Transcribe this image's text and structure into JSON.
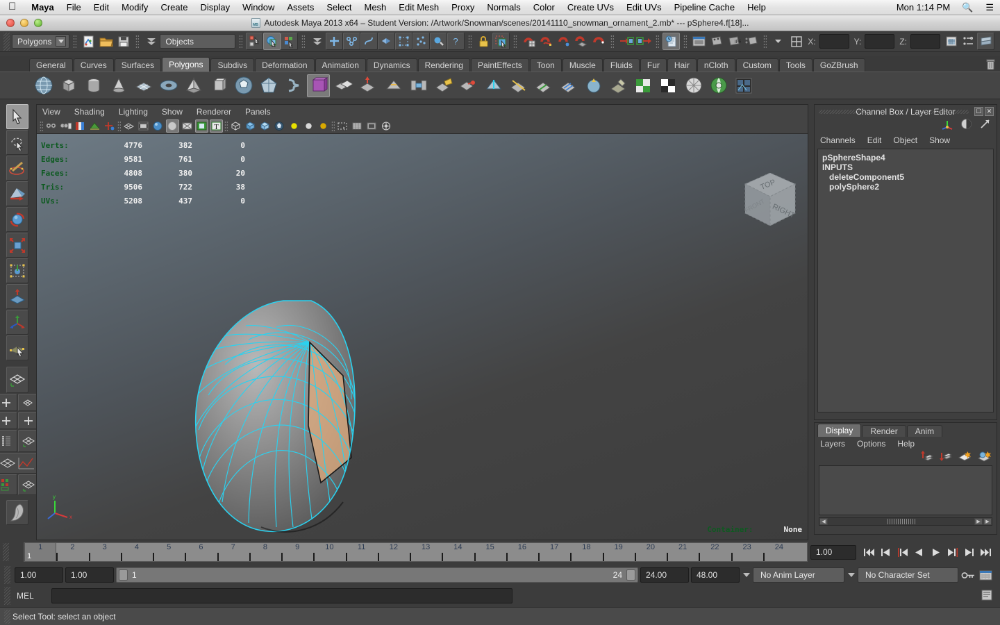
{
  "mac_menu": {
    "apple_icon": "apple-logo-icon",
    "items": [
      "Maya",
      "File",
      "Edit",
      "Modify",
      "Create",
      "Display",
      "Window",
      "Assets",
      "Select",
      "Mesh",
      "Edit Mesh",
      "Proxy",
      "Normals",
      "Color",
      "Create UVs",
      "Edit UVs",
      "Pipeline Cache",
      "Help"
    ],
    "clock": "Mon 1:14 PM",
    "search_icon": "search-icon",
    "list_icon": "list-icon"
  },
  "window": {
    "title": "Autodesk Maya 2013 x64 – Student Version: /Artwork/Snowman/scenes/20141110_snowman_ornament_2.mb*  ---  pSphere4.f[18]...",
    "file_icon": "maya-binary-file-icon",
    "close_label": "close-button",
    "minimize_label": "minimize-button",
    "zoom_label": "zoom-button"
  },
  "status_line": {
    "menu_set": "Polygons",
    "selection_mask": "Objects",
    "x_label": "X:",
    "y_label": "Y:",
    "z_label": "Z:",
    "x_value": "",
    "y_value": "",
    "z_value": "",
    "icons": [
      "new-scene-icon",
      "open-scene-icon",
      "save-scene-icon",
      "select-by-hierarchy-icon",
      "select-by-object-type-icon",
      "select-by-component-type-icon",
      "select-mask-menu-icon",
      "handles-mask-icon",
      "joints-mask-icon",
      "curves-mask-icon",
      "surfaces-mask-icon",
      "deformations-mask-icon",
      "dynamics-mask-icon",
      "rendering-mask-icon",
      "misc-mask-icon",
      "lock-selection-icon",
      "highlight-selection-icon",
      "snap-to-grid-icon",
      "snap-to-curve-icon",
      "snap-to-point-icon",
      "snap-to-projected-center-icon",
      "snap-to-view-plane-icon",
      "make-live-icon",
      "construction-history-icon",
      "render-current-frame-icon",
      "ipr-render-icon",
      "render-settings-icon",
      "hypershade-icon",
      "render-view-icon",
      "attribute-editor-icon",
      "tool-settings-icon",
      "channel-box-icon"
    ]
  },
  "shelf": {
    "tabs": [
      "General",
      "Curves",
      "Surfaces",
      "Polygons",
      "Subdivs",
      "Deformation",
      "Animation",
      "Dynamics",
      "Rendering",
      "PaintEffects",
      "Toon",
      "Muscle",
      "Fluids",
      "Fur",
      "Hair",
      "nCloth",
      "Custom",
      "Tools",
      "GoZBrush"
    ],
    "selected_tab": "Polygons",
    "trash_icon": "shelf-trash-icon",
    "items": [
      "poly-sphere-icon",
      "poly-cube-icon",
      "poly-cylinder-icon",
      "poly-cone-icon",
      "poly-plane-icon",
      "poly-torus-icon",
      "poly-pyramid-icon",
      "poly-prism-icon",
      "poly-platonic-icon",
      "poly-soccer-ball-icon",
      "poly-helix-icon",
      "poly-gear-icon",
      "poly-combine-icon",
      "poly-extrude-icon",
      "poly-bevel-icon",
      "poly-bridge-icon",
      "poly-append-icon",
      "poly-merge-icon",
      "poly-split-icon",
      "poly-cut-icon",
      "poly-insert-edge-loop-icon",
      "poly-offset-edge-loop-icon",
      "poly-smooth-icon",
      "poly-sculpt-geometry-icon",
      "uv-texture-editor-icon",
      "uv-checker-icon",
      "uv-planar-map-icon",
      "uv-layout-icon",
      "uv-snapshot-icon"
    ]
  },
  "toolbox": {
    "tools": [
      {
        "name": "select-tool",
        "selected": true
      },
      {
        "name": "lasso-select-tool",
        "selected": false
      },
      {
        "name": "paint-selection-tool",
        "selected": false
      },
      {
        "name": "move-tool",
        "selected": false
      },
      {
        "name": "rotate-tool",
        "selected": false
      },
      {
        "name": "scale-tool",
        "selected": false
      },
      {
        "name": "universal-manipulator-tool",
        "selected": false
      },
      {
        "name": "soft-modification-tool",
        "selected": false
      },
      {
        "name": "show-manipulator-tool",
        "selected": false
      },
      {
        "name": "last-tool-used",
        "selected": false
      }
    ],
    "layouts": [
      "single-perspective-layout",
      "four-view-layout",
      "two-panes-side-layout",
      "two-panes-stacked-layout",
      "outliner-persp-layout",
      "persp-graph-layout",
      "hypershade-persp-layout"
    ],
    "paint_icon": "paint-effects-icon"
  },
  "viewport": {
    "menus": [
      "View",
      "Shading",
      "Lighting",
      "Show",
      "Renderer",
      "Panels"
    ],
    "toolbar_icons": [
      "select-camera-icon",
      "camera-attributes-icon",
      "bookmarks-icon",
      "image-plane-icon",
      "twopoint-constraint-icon",
      "wireframe-shading-icon",
      "smooth-shade-all-icon",
      "smooth-shade-selected-icon",
      "flat-shade-icon",
      "wireframe-on-shaded-icon",
      "texture-display-icon",
      "lighting-display-icon",
      "shadows-icon",
      "xray-display-icon",
      "xray-joints-icon",
      "xray-active-components-icon",
      "high-quality-render-icon",
      "no-lights-icon",
      "default-light-icon",
      "all-lights-icon",
      "isolate-select-icon",
      "grid-display-icon",
      "film-gate-icon",
      "exposure-icon"
    ],
    "hud": {
      "columns": 3,
      "rows": [
        {
          "label": "Verts:",
          "total": "4776",
          "visible": "382",
          "selected": "0"
        },
        {
          "label": "Edges:",
          "total": "9581",
          "visible": "761",
          "selected": "0"
        },
        {
          "label": "Faces:",
          "total": "4808",
          "visible": "380",
          "selected": "20"
        },
        {
          "label": "Tris:",
          "total": "9506",
          "visible": "722",
          "selected": "38"
        },
        {
          "label": "UVs:",
          "total": "5208",
          "visible": "437",
          "selected": "0"
        }
      ]
    },
    "container_label": "Container:",
    "container_value": "None",
    "view_cube": {
      "top": "TOP",
      "front": "FRONT",
      "right": "RIGHT"
    },
    "axis": {
      "x": "x",
      "y": "y",
      "z": "z"
    },
    "hud_label_color": "#0d5a20",
    "wireframe_color": "#2ad2f0",
    "selected_face_color": "#e8b080"
  },
  "channel_box": {
    "title": "Channel Box / Layer Editor",
    "menus": [
      "Channels",
      "Edit",
      "Object",
      "Show"
    ],
    "icons": [
      "channel-box-toggle-icon",
      "attribute-editor-toggle-icon",
      "tool-settings-toggle-icon"
    ],
    "nodes": [
      "pSphereShape4",
      "INPUTS",
      "deleteComponent5",
      "polySphere2"
    ],
    "restore_btn": "restore-window-button",
    "close_btn": "close-window-button"
  },
  "layer_editor": {
    "tabs": [
      "Display",
      "Render",
      "Anim"
    ],
    "selected_tab": "Display",
    "menus": [
      "Layers",
      "Options",
      "Help"
    ],
    "icons": [
      "move-layer-up-icon",
      "move-layer-down-icon",
      "new-layer-icon",
      "new-layer-from-selected-icon"
    ],
    "layers": []
  },
  "time_slider": {
    "ticks": [
      "1",
      "2",
      "3",
      "4",
      "5",
      "6",
      "7",
      "8",
      "9",
      "10",
      "11",
      "12",
      "13",
      "14",
      "15",
      "16",
      "17",
      "18",
      "19",
      "20",
      "21",
      "22",
      "23",
      "24"
    ],
    "current_frame_label": "1",
    "current_time": "1.00",
    "transport": [
      "go-to-start-icon",
      "step-back-keyframe-icon",
      "step-back-frame-icon",
      "play-backwards-icon",
      "play-forwards-icon",
      "step-forward-frame-icon",
      "step-forward-keyframe-icon",
      "go-to-end-icon"
    ]
  },
  "range_slider": {
    "anim_start": "1.00",
    "range_start": "1.00",
    "bar_start": "1",
    "bar_end": "24",
    "range_end": "24.00",
    "anim_end": "48.00",
    "anim_layer": "No Anim Layer",
    "character_set": "No Character Set",
    "auto_key_icon": "auto-keyframe-icon",
    "anim_prefs_icon": "animation-preferences-icon"
  },
  "command_line": {
    "label": "MEL",
    "value": "",
    "script_editor_icon": "script-editor-icon"
  },
  "help_line": {
    "text": "Select Tool: select an object"
  }
}
